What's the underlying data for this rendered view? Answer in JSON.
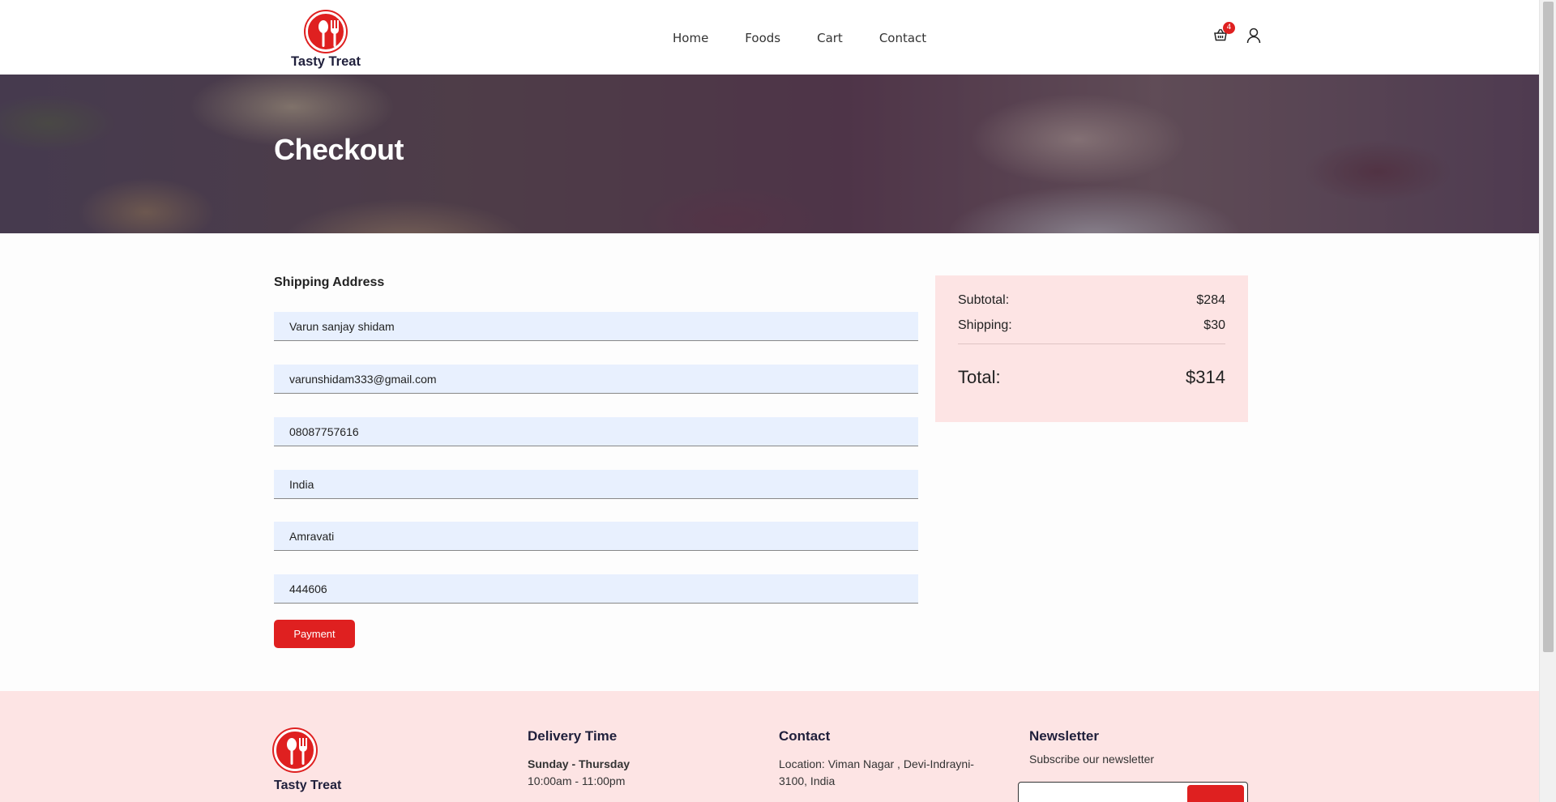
{
  "brand": {
    "name": "Tasty Treat"
  },
  "nav": {
    "items": [
      {
        "label": "Home"
      },
      {
        "label": "Foods"
      },
      {
        "label": "Cart"
      },
      {
        "label": "Contact"
      }
    ]
  },
  "header": {
    "cart_count": "4"
  },
  "hero": {
    "title": "Checkout"
  },
  "form": {
    "title": "Shipping Address",
    "fields": [
      {
        "value": "Varun sanjay shidam"
      },
      {
        "value": "varunshidam333@gmail.com"
      },
      {
        "value": "08087757616"
      },
      {
        "value": "India"
      },
      {
        "value": "Amravati"
      },
      {
        "value": "444606"
      }
    ],
    "submit_label": "Payment"
  },
  "summary": {
    "subtotal_label": "Subtotal:",
    "subtotal_value": "$284",
    "shipping_label": "Shipping:",
    "shipping_value": "$30",
    "total_label": "Total:",
    "total_value": "$314"
  },
  "footer": {
    "brand": "Tasty Treat",
    "delivery": {
      "title": "Delivery Time",
      "days": "Sunday - Thursday",
      "hours": "10:00am - 11:00pm"
    },
    "contact": {
      "title": "Contact",
      "location": "Location: Viman Nagar , Devi-Indrayni-3100, India"
    },
    "newsletter": {
      "title": "Newsletter",
      "subtitle": "Subscribe our newsletter"
    }
  },
  "colors": {
    "accent": "#df2020",
    "summary_bg": "#fde4e4",
    "field_bg": "#e8f0fe",
    "brand_text": "#1f1f3b"
  }
}
